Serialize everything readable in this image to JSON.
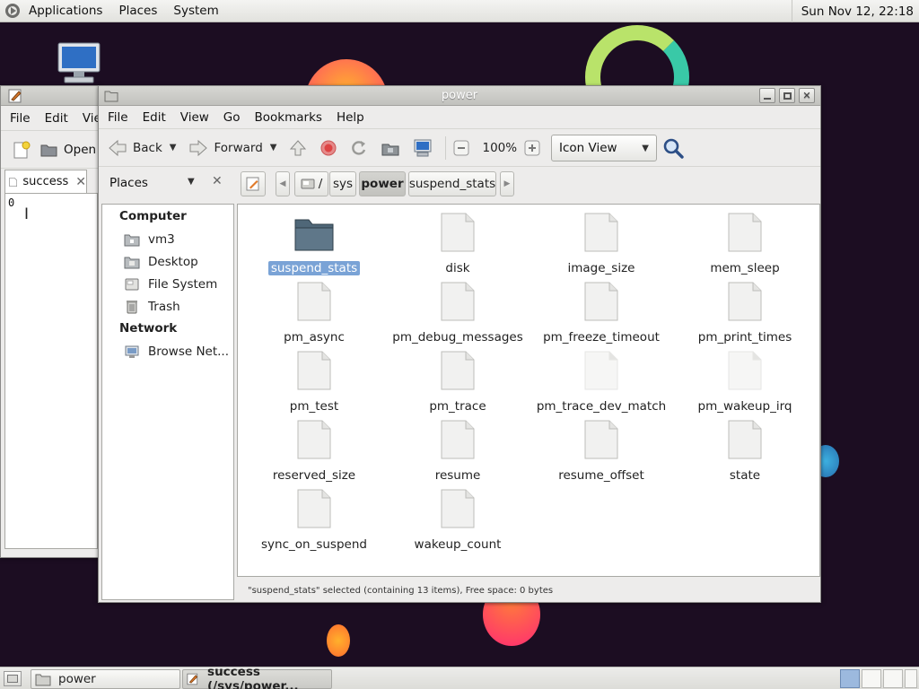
{
  "top_panel": {
    "menus": [
      "Applications",
      "Places",
      "System"
    ],
    "clock": "Sun Nov 12, 22:18"
  },
  "back_window": {
    "menus": [
      "File",
      "Edit",
      "View"
    ],
    "open_label": "Open",
    "tab_label": "success",
    "content": "0"
  },
  "window": {
    "title": "power",
    "menus": [
      "File",
      "Edit",
      "View",
      "Go",
      "Bookmarks",
      "Help"
    ],
    "toolbar": {
      "back": "Back",
      "forward": "Forward",
      "zoom": "100%",
      "view_mode": "Icon View"
    },
    "places_label": "Places",
    "breadcrumbs": [
      "/",
      "sys",
      "power",
      "suspend_stats"
    ],
    "sidebar": {
      "computer_header": "Computer",
      "computer_items": [
        "vm3",
        "Desktop",
        "File System",
        "Trash"
      ],
      "network_header": "Network",
      "network_items": [
        "Browse Net..."
      ]
    },
    "files": [
      {
        "name": "suspend_stats",
        "kind": "folder",
        "selected": true
      },
      {
        "name": "disk",
        "kind": "file"
      },
      {
        "name": "image_size",
        "kind": "file"
      },
      {
        "name": "mem_sleep",
        "kind": "file"
      },
      {
        "name": "pm_async",
        "kind": "file"
      },
      {
        "name": "pm_debug_messages",
        "kind": "file"
      },
      {
        "name": "pm_freeze_timeout",
        "kind": "file"
      },
      {
        "name": "pm_print_times",
        "kind": "file"
      },
      {
        "name": "pm_test",
        "kind": "file"
      },
      {
        "name": "pm_trace",
        "kind": "file"
      },
      {
        "name": "pm_trace_dev_match",
        "kind": "file-faded"
      },
      {
        "name": "pm_wakeup_irq",
        "kind": "file-faded"
      },
      {
        "name": "reserved_size",
        "kind": "file"
      },
      {
        "name": "resume",
        "kind": "file"
      },
      {
        "name": "resume_offset",
        "kind": "file"
      },
      {
        "name": "state",
        "kind": "file"
      },
      {
        "name": "sync_on_suspend",
        "kind": "file"
      },
      {
        "name": "wakeup_count",
        "kind": "file"
      }
    ],
    "status": "\"suspend_stats\" selected (containing 13 items), Free space: 0 bytes"
  },
  "taskbar": {
    "items": [
      "power",
      "success (/sys/power..."
    ]
  },
  "colors": {
    "selection": "#7aa3d6",
    "desktop": "#1c0d22",
    "folder": "#4f6778"
  }
}
